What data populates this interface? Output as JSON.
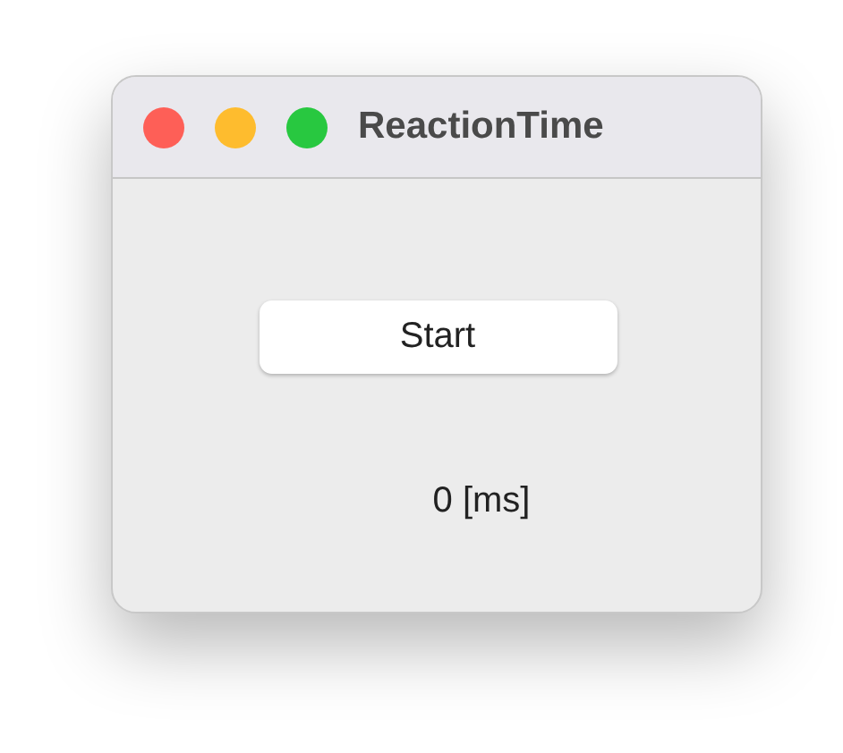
{
  "window": {
    "title": "ReactionTime",
    "controls": [
      {
        "kind": "close"
      },
      {
        "kind": "minimize"
      },
      {
        "kind": "zoom"
      }
    ]
  },
  "button": {
    "label": "Start"
  },
  "result": "0 [ms]"
}
